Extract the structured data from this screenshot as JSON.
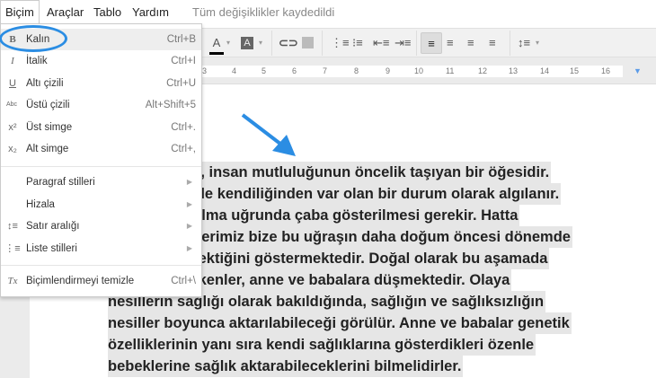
{
  "menubar": {
    "items": [
      "Biçim",
      "Araçlar",
      "Tablo",
      "Yardım"
    ],
    "status": "Tüm değişiklikler kaydedildi"
  },
  "toolbar": {
    "text_color": "A",
    "highlight": "A",
    "line_spacing_caret": "▾"
  },
  "ruler": {
    "ticks": [
      "3",
      "4",
      "5",
      "6",
      "7",
      "8",
      "9",
      "10",
      "11",
      "12",
      "13",
      "14",
      "15",
      "16",
      "17"
    ]
  },
  "format_menu": {
    "items": [
      {
        "icon": "bold-icon",
        "glyph": "B",
        "label": "Kalın",
        "shortcut": "Ctrl+B"
      },
      {
        "icon": "italic-icon",
        "glyph": "I",
        "label": "İtalik",
        "shortcut": "Ctrl+I"
      },
      {
        "icon": "underline-icon",
        "glyph": "U",
        "label": "Altı çizili",
        "shortcut": "Ctrl+U"
      },
      {
        "icon": "strikethrough-icon",
        "glyph": "Abc",
        "label": "Üstü çizili",
        "shortcut": "Alt+Shift+5"
      },
      {
        "icon": "superscript-icon",
        "glyph": "x²",
        "label": "Üst simge",
        "shortcut": "Ctrl+."
      },
      {
        "icon": "subscript-icon",
        "glyph": "x₂",
        "label": "Alt simge",
        "shortcut": "Ctrl+,"
      }
    ],
    "submenus": [
      {
        "icon": "",
        "glyph": "",
        "label": "Paragraf stilleri"
      },
      {
        "icon": "",
        "glyph": "",
        "label": "Hizala"
      },
      {
        "icon": "line-spacing-icon",
        "glyph": "↕≡",
        "label": "Satır aralığı"
      },
      {
        "icon": "list-icon",
        "glyph": "⋮≡",
        "label": "Liste stilleri"
      }
    ],
    "clear": {
      "icon": "clear-formatting-icon",
      "glyph": "Tx",
      "label": "Biçimlendirmeyi temizle",
      "shortcut": "Ctrl+\\"
    }
  },
  "document": {
    "lines": [
      "ak, insan mutluluğunun öncelik taşıyan bir öğesidir.",
      "likle kendiliğinden var olan bir durum olarak algılanır.",
      "ı olma uğrunda çaba gösterilmesi gerekir. Hatta",
      "gilerimiz bize bu uğraşın daha doğum öncesi dönemde",
      "erektiğini göstermektedir. Doğal olarak bu aşamada",
      "rekenler, anne ve babalara düşmektedir. Olaya",
      "nesillerin sağlığı olarak bakıldığında, sağlığın ve sağlıksızlığın",
      "nesiller boyunca aktarılabileceği görülür. Anne ve babalar genetik",
      "özelliklerinin yanı sıra kendi sağlıklarına gösterdikleri özenle",
      "bebeklerine sağlık aktarabileceklerini bilmelidirler."
    ]
  },
  "colors": {
    "annotation": "#2b8de3",
    "selection": "#e6e6e6"
  }
}
